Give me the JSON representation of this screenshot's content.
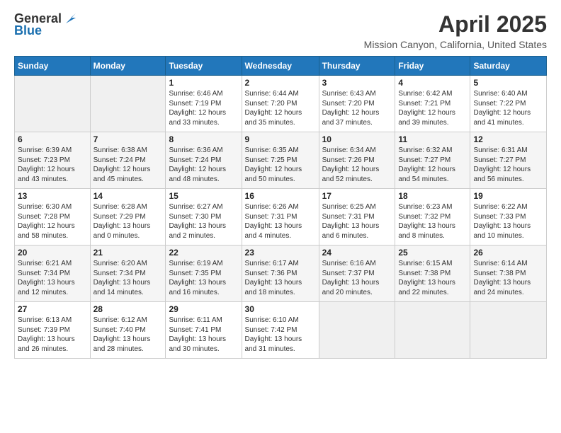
{
  "header": {
    "logo_general": "General",
    "logo_blue": "Blue",
    "title": "April 2025",
    "location": "Mission Canyon, California, United States"
  },
  "weekdays": [
    "Sunday",
    "Monday",
    "Tuesday",
    "Wednesday",
    "Thursday",
    "Friday",
    "Saturday"
  ],
  "weeks": [
    [
      {
        "day": "",
        "sunrise": "",
        "sunset": "",
        "daylight": ""
      },
      {
        "day": "",
        "sunrise": "",
        "sunset": "",
        "daylight": ""
      },
      {
        "day": "1",
        "sunrise": "Sunrise: 6:46 AM",
        "sunset": "Sunset: 7:19 PM",
        "daylight": "Daylight: 12 hours and 33 minutes."
      },
      {
        "day": "2",
        "sunrise": "Sunrise: 6:44 AM",
        "sunset": "Sunset: 7:20 PM",
        "daylight": "Daylight: 12 hours and 35 minutes."
      },
      {
        "day": "3",
        "sunrise": "Sunrise: 6:43 AM",
        "sunset": "Sunset: 7:20 PM",
        "daylight": "Daylight: 12 hours and 37 minutes."
      },
      {
        "day": "4",
        "sunrise": "Sunrise: 6:42 AM",
        "sunset": "Sunset: 7:21 PM",
        "daylight": "Daylight: 12 hours and 39 minutes."
      },
      {
        "day": "5",
        "sunrise": "Sunrise: 6:40 AM",
        "sunset": "Sunset: 7:22 PM",
        "daylight": "Daylight: 12 hours and 41 minutes."
      }
    ],
    [
      {
        "day": "6",
        "sunrise": "Sunrise: 6:39 AM",
        "sunset": "Sunset: 7:23 PM",
        "daylight": "Daylight: 12 hours and 43 minutes."
      },
      {
        "day": "7",
        "sunrise": "Sunrise: 6:38 AM",
        "sunset": "Sunset: 7:24 PM",
        "daylight": "Daylight: 12 hours and 45 minutes."
      },
      {
        "day": "8",
        "sunrise": "Sunrise: 6:36 AM",
        "sunset": "Sunset: 7:24 PM",
        "daylight": "Daylight: 12 hours and 48 minutes."
      },
      {
        "day": "9",
        "sunrise": "Sunrise: 6:35 AM",
        "sunset": "Sunset: 7:25 PM",
        "daylight": "Daylight: 12 hours and 50 minutes."
      },
      {
        "day": "10",
        "sunrise": "Sunrise: 6:34 AM",
        "sunset": "Sunset: 7:26 PM",
        "daylight": "Daylight: 12 hours and 52 minutes."
      },
      {
        "day": "11",
        "sunrise": "Sunrise: 6:32 AM",
        "sunset": "Sunset: 7:27 PM",
        "daylight": "Daylight: 12 hours and 54 minutes."
      },
      {
        "day": "12",
        "sunrise": "Sunrise: 6:31 AM",
        "sunset": "Sunset: 7:27 PM",
        "daylight": "Daylight: 12 hours and 56 minutes."
      }
    ],
    [
      {
        "day": "13",
        "sunrise": "Sunrise: 6:30 AM",
        "sunset": "Sunset: 7:28 PM",
        "daylight": "Daylight: 12 hours and 58 minutes."
      },
      {
        "day": "14",
        "sunrise": "Sunrise: 6:28 AM",
        "sunset": "Sunset: 7:29 PM",
        "daylight": "Daylight: 13 hours and 0 minutes."
      },
      {
        "day": "15",
        "sunrise": "Sunrise: 6:27 AM",
        "sunset": "Sunset: 7:30 PM",
        "daylight": "Daylight: 13 hours and 2 minutes."
      },
      {
        "day": "16",
        "sunrise": "Sunrise: 6:26 AM",
        "sunset": "Sunset: 7:31 PM",
        "daylight": "Daylight: 13 hours and 4 minutes."
      },
      {
        "day": "17",
        "sunrise": "Sunrise: 6:25 AM",
        "sunset": "Sunset: 7:31 PM",
        "daylight": "Daylight: 13 hours and 6 minutes."
      },
      {
        "day": "18",
        "sunrise": "Sunrise: 6:23 AM",
        "sunset": "Sunset: 7:32 PM",
        "daylight": "Daylight: 13 hours and 8 minutes."
      },
      {
        "day": "19",
        "sunrise": "Sunrise: 6:22 AM",
        "sunset": "Sunset: 7:33 PM",
        "daylight": "Daylight: 13 hours and 10 minutes."
      }
    ],
    [
      {
        "day": "20",
        "sunrise": "Sunrise: 6:21 AM",
        "sunset": "Sunset: 7:34 PM",
        "daylight": "Daylight: 13 hours and 12 minutes."
      },
      {
        "day": "21",
        "sunrise": "Sunrise: 6:20 AM",
        "sunset": "Sunset: 7:34 PM",
        "daylight": "Daylight: 13 hours and 14 minutes."
      },
      {
        "day": "22",
        "sunrise": "Sunrise: 6:19 AM",
        "sunset": "Sunset: 7:35 PM",
        "daylight": "Daylight: 13 hours and 16 minutes."
      },
      {
        "day": "23",
        "sunrise": "Sunrise: 6:17 AM",
        "sunset": "Sunset: 7:36 PM",
        "daylight": "Daylight: 13 hours and 18 minutes."
      },
      {
        "day": "24",
        "sunrise": "Sunrise: 6:16 AM",
        "sunset": "Sunset: 7:37 PM",
        "daylight": "Daylight: 13 hours and 20 minutes."
      },
      {
        "day": "25",
        "sunrise": "Sunrise: 6:15 AM",
        "sunset": "Sunset: 7:38 PM",
        "daylight": "Daylight: 13 hours and 22 minutes."
      },
      {
        "day": "26",
        "sunrise": "Sunrise: 6:14 AM",
        "sunset": "Sunset: 7:38 PM",
        "daylight": "Daylight: 13 hours and 24 minutes."
      }
    ],
    [
      {
        "day": "27",
        "sunrise": "Sunrise: 6:13 AM",
        "sunset": "Sunset: 7:39 PM",
        "daylight": "Daylight: 13 hours and 26 minutes."
      },
      {
        "day": "28",
        "sunrise": "Sunrise: 6:12 AM",
        "sunset": "Sunset: 7:40 PM",
        "daylight": "Daylight: 13 hours and 28 minutes."
      },
      {
        "day": "29",
        "sunrise": "Sunrise: 6:11 AM",
        "sunset": "Sunset: 7:41 PM",
        "daylight": "Daylight: 13 hours and 30 minutes."
      },
      {
        "day": "30",
        "sunrise": "Sunrise: 6:10 AM",
        "sunset": "Sunset: 7:42 PM",
        "daylight": "Daylight: 13 hours and 31 minutes."
      },
      {
        "day": "",
        "sunrise": "",
        "sunset": "",
        "daylight": ""
      },
      {
        "day": "",
        "sunrise": "",
        "sunset": "",
        "daylight": ""
      },
      {
        "day": "",
        "sunrise": "",
        "sunset": "",
        "daylight": ""
      }
    ]
  ]
}
